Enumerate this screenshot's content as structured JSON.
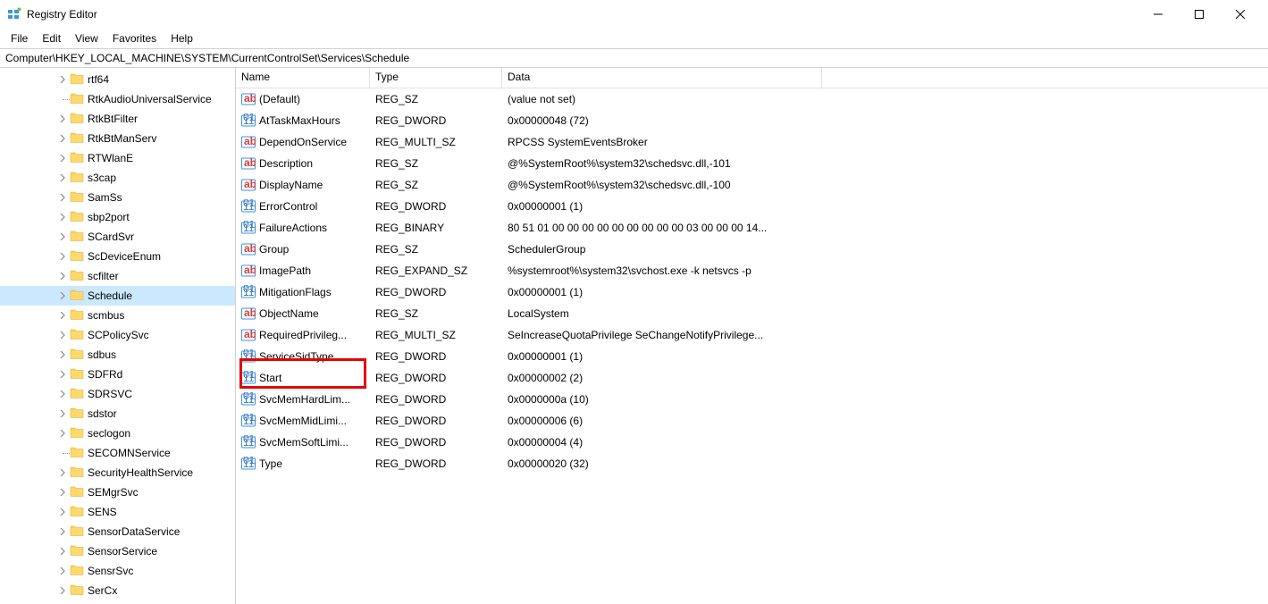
{
  "window": {
    "title": "Registry Editor"
  },
  "menu": [
    "File",
    "Edit",
    "View",
    "Favorites",
    "Help"
  ],
  "address": "Computer\\HKEY_LOCAL_MACHINE\\SYSTEM\\CurrentControlSet\\Services\\Schedule",
  "tree": [
    {
      "label": "rtf64",
      "expandable": true
    },
    {
      "label": "RtkAudioUniversalService",
      "expandable": false,
      "line": true
    },
    {
      "label": "RtkBtFilter",
      "expandable": true
    },
    {
      "label": "RtkBtManServ",
      "expandable": true
    },
    {
      "label": "RTWlanE",
      "expandable": true
    },
    {
      "label": "s3cap",
      "expandable": true
    },
    {
      "label": "SamSs",
      "expandable": true
    },
    {
      "label": "sbp2port",
      "expandable": true
    },
    {
      "label": "SCardSvr",
      "expandable": true
    },
    {
      "label": "ScDeviceEnum",
      "expandable": true
    },
    {
      "label": "scfilter",
      "expandable": true
    },
    {
      "label": "Schedule",
      "expandable": true,
      "selected": true
    },
    {
      "label": "scmbus",
      "expandable": true
    },
    {
      "label": "SCPolicySvc",
      "expandable": true
    },
    {
      "label": "sdbus",
      "expandable": true
    },
    {
      "label": "SDFRd",
      "expandable": true
    },
    {
      "label": "SDRSVC",
      "expandable": true
    },
    {
      "label": "sdstor",
      "expandable": true
    },
    {
      "label": "seclogon",
      "expandable": true
    },
    {
      "label": "SECOMNService",
      "expandable": false,
      "line": true
    },
    {
      "label": "SecurityHealthService",
      "expandable": true
    },
    {
      "label": "SEMgrSvc",
      "expandable": true
    },
    {
      "label": "SENS",
      "expandable": true
    },
    {
      "label": "SensorDataService",
      "expandable": true
    },
    {
      "label": "SensorService",
      "expandable": true
    },
    {
      "label": "SensrSvc",
      "expandable": true
    },
    {
      "label": "SerCx",
      "expandable": true
    }
  ],
  "columns": {
    "name": "Name",
    "type": "Type",
    "data": "Data"
  },
  "values": [
    {
      "name": "(Default)",
      "type": "REG_SZ",
      "data": "(value not set)",
      "icon": "string"
    },
    {
      "name": "AtTaskMaxHours",
      "type": "REG_DWORD",
      "data": "0x00000048 (72)",
      "icon": "binary"
    },
    {
      "name": "DependOnService",
      "type": "REG_MULTI_SZ",
      "data": "RPCSS SystemEventsBroker",
      "icon": "string"
    },
    {
      "name": "Description",
      "type": "REG_SZ",
      "data": "@%SystemRoot%\\system32\\schedsvc.dll,-101",
      "icon": "string"
    },
    {
      "name": "DisplayName",
      "type": "REG_SZ",
      "data": "@%SystemRoot%\\system32\\schedsvc.dll,-100",
      "icon": "string"
    },
    {
      "name": "ErrorControl",
      "type": "REG_DWORD",
      "data": "0x00000001 (1)",
      "icon": "binary"
    },
    {
      "name": "FailureActions",
      "type": "REG_BINARY",
      "data": "80 51 01 00 00 00 00 00 00 00 00 00 03 00 00 00 14...",
      "icon": "binary"
    },
    {
      "name": "Group",
      "type": "REG_SZ",
      "data": "SchedulerGroup",
      "icon": "string"
    },
    {
      "name": "ImagePath",
      "type": "REG_EXPAND_SZ",
      "data": "%systemroot%\\system32\\svchost.exe -k netsvcs -p",
      "icon": "string"
    },
    {
      "name": "MitigationFlags",
      "type": "REG_DWORD",
      "data": "0x00000001 (1)",
      "icon": "binary"
    },
    {
      "name": "ObjectName",
      "type": "REG_SZ",
      "data": "LocalSystem",
      "icon": "string"
    },
    {
      "name": "RequiredPrivileg...",
      "type": "REG_MULTI_SZ",
      "data": "SeIncreaseQuotaPrivilege SeChangeNotifyPrivilege...",
      "icon": "string"
    },
    {
      "name": "ServiceSidType",
      "type": "REG_DWORD",
      "data": "0x00000001 (1)",
      "icon": "binary"
    },
    {
      "name": "Start",
      "type": "REG_DWORD",
      "data": "0x00000002 (2)",
      "icon": "binary",
      "highlight": true
    },
    {
      "name": "SvcMemHardLim...",
      "type": "REG_DWORD",
      "data": "0x0000000a (10)",
      "icon": "binary"
    },
    {
      "name": "SvcMemMidLimi...",
      "type": "REG_DWORD",
      "data": "0x00000006 (6)",
      "icon": "binary"
    },
    {
      "name": "SvcMemSoftLimi...",
      "type": "REG_DWORD",
      "data": "0x00000004 (4)",
      "icon": "binary"
    },
    {
      "name": "Type",
      "type": "REG_DWORD",
      "data": "0x00000020 (32)",
      "icon": "binary"
    }
  ]
}
